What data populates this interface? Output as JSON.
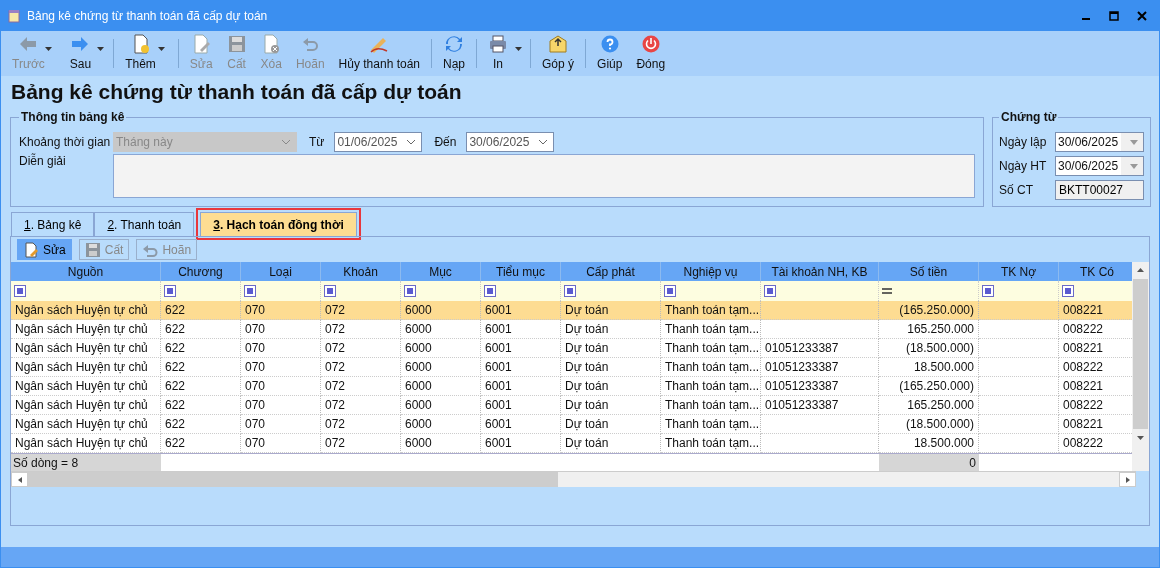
{
  "window": {
    "title": "Bảng kê chứng từ thanh toán đã cấp dự toán"
  },
  "toolbar": [
    {
      "kind": "back",
      "label": "Trước",
      "disabled": true,
      "dropdown": true
    },
    {
      "kind": "forward",
      "label": "Sau",
      "disabled": false,
      "dropdown": true
    },
    {
      "kind": "new",
      "label": "Thêm",
      "disabled": false,
      "dropdown": true
    },
    {
      "kind": "edit",
      "label": "Sửa",
      "disabled": true,
      "dropdown": false
    },
    {
      "kind": "save",
      "label": "Cất",
      "disabled": true,
      "dropdown": false
    },
    {
      "kind": "delete",
      "label": "Xóa",
      "disabled": true,
      "dropdown": false
    },
    {
      "kind": "undo",
      "label": "Hoãn",
      "disabled": true,
      "dropdown": false
    },
    {
      "kind": "cancel",
      "label": "Hủy thanh toán",
      "disabled": false,
      "dropdown": false
    },
    {
      "kind": "reload",
      "label": "Nạp",
      "disabled": false,
      "dropdown": false
    },
    {
      "kind": "print",
      "label": "In",
      "disabled": false,
      "dropdown": true
    },
    {
      "kind": "feedback",
      "label": "Góp ý",
      "disabled": false,
      "dropdown": false
    },
    {
      "kind": "help",
      "label": "Giúp",
      "disabled": false,
      "dropdown": false
    },
    {
      "kind": "close",
      "label": "Đóng",
      "disabled": false,
      "dropdown": false
    }
  ],
  "heading": "Bảng kê chứng từ thanh toán đã cấp dự toán",
  "info_group": {
    "title": "Thông tin bảng kê",
    "period_label": "Khoảng thời gian",
    "period_value": "Tháng này",
    "period_disabled": true,
    "from_label": "Từ",
    "from_value": "01/06/2025",
    "to_label": "Đến",
    "to_value": "30/06/2025",
    "description_label": "Diễn giải"
  },
  "voucher_group": {
    "title": "Chứng từ",
    "date_label": "Ngày lập",
    "date_value": "30/06/2025",
    "post_date_label": "Ngày HT",
    "post_date_value": "30/06/2025",
    "number_label": "Số CT",
    "number_value": "BKTT00027"
  },
  "tabs": [
    {
      "key": "1",
      "label": ". Bảng kê",
      "selected": false
    },
    {
      "key": "2",
      "label": ". Thanh toán",
      "selected": false
    },
    {
      "key": "3",
      "label": ". Hạch toán đồng thời",
      "selected": true
    }
  ],
  "tab_toolbar": [
    {
      "kind": "edit",
      "label": "Sửa",
      "disabled": false
    },
    {
      "kind": "save",
      "label": "Cất",
      "disabled": true
    },
    {
      "kind": "undo",
      "label": "Hoãn",
      "disabled": true
    }
  ],
  "table": {
    "columns": [
      {
        "label": "Nguồn",
        "kind": "text"
      },
      {
        "label": "Chương",
        "kind": "text"
      },
      {
        "label": "Loại",
        "kind": "text"
      },
      {
        "label": "Khoản",
        "kind": "text"
      },
      {
        "label": "Mục",
        "kind": "text"
      },
      {
        "label": "Tiểu mục",
        "kind": "text"
      },
      {
        "label": "Cấp phát",
        "kind": "text"
      },
      {
        "label": "Nghiệp vụ",
        "kind": "text"
      },
      {
        "label": "Tài khoản NH, KB",
        "kind": "text"
      },
      {
        "label": "Số tiền",
        "kind": "amount"
      },
      {
        "label": "TK Nợ",
        "kind": "text"
      },
      {
        "label": "TK Có",
        "kind": "text"
      }
    ],
    "filters": [
      {
        "kind": "box"
      },
      {
        "kind": "box"
      },
      {
        "kind": "box"
      },
      {
        "kind": "box"
      },
      {
        "kind": "box"
      },
      {
        "kind": "box"
      },
      {
        "kind": "box"
      },
      {
        "kind": "box"
      },
      {
        "kind": "box"
      },
      {
        "kind": "equals"
      },
      {
        "kind": "box"
      },
      {
        "kind": "box"
      }
    ],
    "rows": [
      {
        "selected": true,
        "cells": [
          "Ngân sách Huyện tự chủ",
          "622",
          "070",
          "072",
          "6000",
          "6001",
          "Dự toán",
          "Thanh toán tạm...",
          "",
          "(165.250.000)",
          "",
          "008221"
        ]
      },
      {
        "selected": false,
        "cells": [
          "Ngân sách Huyện tự chủ",
          "622",
          "070",
          "072",
          "6000",
          "6001",
          "Dự toán",
          "Thanh toán tạm...",
          "",
          "165.250.000",
          "",
          "008222"
        ]
      },
      {
        "selected": false,
        "cells": [
          "Ngân sách Huyện tự chủ",
          "622",
          "070",
          "072",
          "6000",
          "6001",
          "Dự toán",
          "Thanh toán tạm...",
          "01051233387",
          "(18.500.000)",
          "",
          "008221"
        ]
      },
      {
        "selected": false,
        "cells": [
          "Ngân sách Huyện tự chủ",
          "622",
          "070",
          "072",
          "6000",
          "6001",
          "Dự toán",
          "Thanh toán tạm...",
          "01051233387",
          "18.500.000",
          "",
          "008222"
        ]
      },
      {
        "selected": false,
        "cells": [
          "Ngân sách Huyện tự chủ",
          "622",
          "070",
          "072",
          "6000",
          "6001",
          "Dự toán",
          "Thanh toán tạm...",
          "01051233387",
          "(165.250.000)",
          "",
          "008221"
        ]
      },
      {
        "selected": false,
        "cells": [
          "Ngân sách Huyện tự chủ",
          "622",
          "070",
          "072",
          "6000",
          "6001",
          "Dự toán",
          "Thanh toán tạm...",
          "01051233387",
          "165.250.000",
          "",
          "008222"
        ]
      },
      {
        "selected": false,
        "cells": [
          "Ngân sách Huyện tự chủ",
          "622",
          "070",
          "072",
          "6000",
          "6001",
          "Dự toán",
          "Thanh toán tạm...",
          "",
          "(18.500.000)",
          "",
          "008221"
        ]
      },
      {
        "selected": false,
        "cells": [
          "Ngân sách Huyện tự chủ",
          "622",
          "070",
          "072",
          "6000",
          "6001",
          "Dự toán",
          "Thanh toán tạm...",
          "",
          "18.500.000",
          "",
          "008222"
        ]
      }
    ],
    "row_count": "Số dòng = 8",
    "total": "0"
  }
}
